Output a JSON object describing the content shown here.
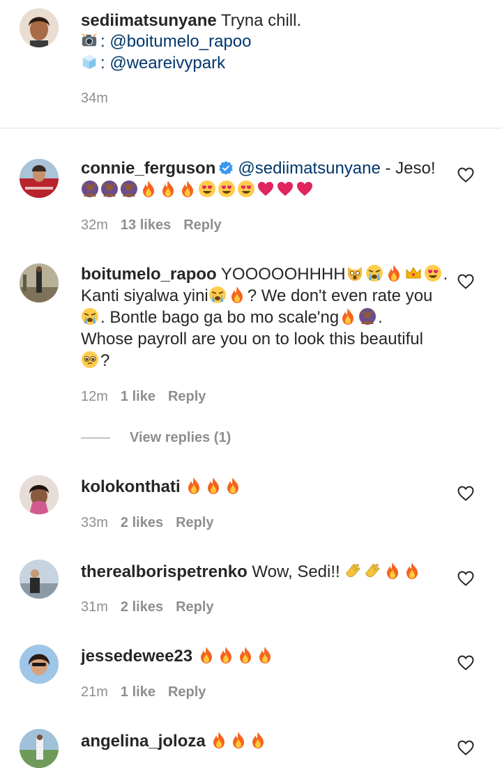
{
  "caption": {
    "username": "sediimatsunyane",
    "text": "Tryna chill.",
    "photo_credit_handle": "@boitumelo_rapoo",
    "style_credit_handle": "@weareivypark",
    "separator": ":",
    "time": "34m",
    "icons": [
      "camera-emoji",
      "ice-cube-emoji"
    ]
  },
  "comments": [
    {
      "username": "connie_ferguson",
      "verified": true,
      "mention": "@sediimatsunyane",
      "text": " - Jeso!",
      "emoji": [
        "woman-raising-hand",
        "woman-raising-hand",
        "woman-raising-hand",
        "fire",
        "fire",
        "fire",
        "heart-eyes",
        "heart-eyes",
        "heart-eyes",
        "red-heart",
        "red-heart",
        "red-heart"
      ],
      "time": "32m",
      "likes": "13 likes",
      "reply": "Reply"
    },
    {
      "username": "boitumelo_rapoo",
      "line1": "YOOOOOHHHH",
      "line1_end": ".",
      "line2_a": "Kanti siyalwa yini",
      "line2_b": "? We don't even rate you",
      "line3": ". Bontle bago ga bo mo scale'ng",
      "line3_end": ".",
      "line4": "Whose payroll are you on to look this beautiful",
      "line5": "?",
      "time": "12m",
      "likes": "1 like",
      "reply": "Reply",
      "view_replies": "View replies (1)"
    },
    {
      "username": "kolokonthati",
      "emoji": [
        "fire",
        "fire",
        "fire"
      ],
      "time": "33m",
      "likes": "2 likes",
      "reply": "Reply"
    },
    {
      "username": "therealborispetrenko",
      "text": "Wow, Sedi!!",
      "emoji": [
        "clapping",
        "clapping",
        "fire",
        "fire"
      ],
      "time": "31m",
      "likes": "2 likes",
      "reply": "Reply"
    },
    {
      "username": "jessedewee23",
      "emoji": [
        "fire",
        "fire",
        "fire",
        "fire"
      ],
      "time": "21m",
      "likes": "1 like",
      "reply": "Reply"
    },
    {
      "username": "angelina_joloza",
      "emoji": [
        "fire",
        "fire",
        "fire"
      ]
    }
  ],
  "colors": {
    "mention": "#00376b",
    "meta": "#8e8e8e",
    "verified": "#3897f0",
    "fire": "#f5641e",
    "heart": "#e0245e"
  }
}
